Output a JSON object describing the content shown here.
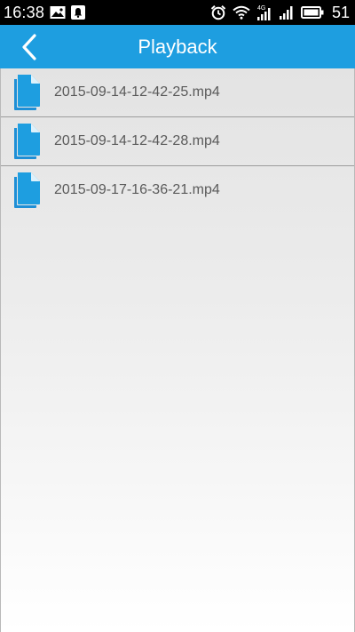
{
  "status_bar": {
    "time": "16:38",
    "battery_level": "51",
    "network_label": "4G",
    "icons": [
      "image-icon",
      "notification-icon",
      "alarm-icon",
      "wifi-icon",
      "signal-4g-icon",
      "signal-icon",
      "battery-icon"
    ]
  },
  "app_bar": {
    "title": "Playback",
    "back_icon": "chevron-left-icon",
    "color": "#1e9ee0"
  },
  "files": [
    {
      "name": "2015-09-14-12-42-25.mp4",
      "icon": "file-icon"
    },
    {
      "name": "2015-09-14-12-42-28.mp4",
      "icon": "file-icon"
    },
    {
      "name": "2015-09-17-16-36-21.mp4",
      "icon": "file-icon"
    }
  ],
  "colors": {
    "accent": "#1e9ee0",
    "icon_blue": "#1e8fd6",
    "text": "#5a5a5a"
  }
}
